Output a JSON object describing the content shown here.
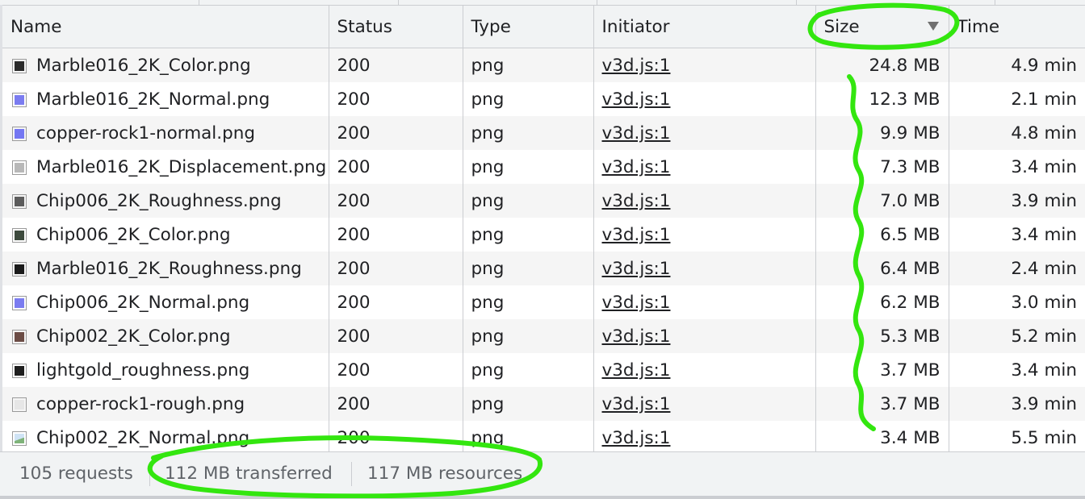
{
  "columns": {
    "name": "Name",
    "status": "Status",
    "type": "Type",
    "initiator": "Initiator",
    "size": "Size",
    "time": "Time"
  },
  "sort": {
    "column": "size",
    "direction": "descending"
  },
  "rows": [
    {
      "name": "Marble016_2K_Color.png",
      "status": "200",
      "type": "png",
      "initiator": "v3d.js:1",
      "size": "24.8 MB",
      "time": "4.9 min",
      "thumb": "#2b2b2b"
    },
    {
      "name": "Marble016_2K_Normal.png",
      "status": "200",
      "type": "png",
      "initiator": "v3d.js:1",
      "size": "12.3 MB",
      "time": "2.1 min",
      "thumb": "#7b7cf0"
    },
    {
      "name": "copper-rock1-normal.png",
      "status": "200",
      "type": "png",
      "initiator": "v3d.js:1",
      "size": "9.9 MB",
      "time": "4.8 min",
      "thumb": "#7477f2"
    },
    {
      "name": "Marble016_2K_Displacement.png",
      "status": "200",
      "type": "png",
      "initiator": "v3d.js:1",
      "size": "7.3 MB",
      "time": "3.4 min",
      "thumb": "#b8b8b8"
    },
    {
      "name": "Chip006_2K_Roughness.png",
      "status": "200",
      "type": "png",
      "initiator": "v3d.js:1",
      "size": "7.0 MB",
      "time": "3.9 min",
      "thumb": "#5c5c5c"
    },
    {
      "name": "Chip006_2K_Color.png",
      "status": "200",
      "type": "png",
      "initiator": "v3d.js:1",
      "size": "6.5 MB",
      "time": "3.4 min",
      "thumb": "#3d4a3d"
    },
    {
      "name": "Marble016_2K_Roughness.png",
      "status": "200",
      "type": "png",
      "initiator": "v3d.js:1",
      "size": "6.4 MB",
      "time": "2.4 min",
      "thumb": "#1a1a1a"
    },
    {
      "name": "Chip006_2K_Normal.png",
      "status": "200",
      "type": "png",
      "initiator": "v3d.js:1",
      "size": "6.2 MB",
      "time": "3.0 min",
      "thumb": "#7b7cf0"
    },
    {
      "name": "Chip002_2K_Color.png",
      "status": "200",
      "type": "png",
      "initiator": "v3d.js:1",
      "size": "5.3 MB",
      "time": "5.2 min",
      "thumb": "#6b4c45"
    },
    {
      "name": "lightgold_roughness.png",
      "status": "200",
      "type": "png",
      "initiator": "v3d.js:1",
      "size": "3.7 MB",
      "time": "3.4 min",
      "thumb": "#1e1e1e"
    },
    {
      "name": "copper-rock1-rough.png",
      "status": "200",
      "type": "png",
      "initiator": "v3d.js:1",
      "size": "3.7 MB",
      "time": "3.9 min",
      "thumb": "#e6e6e6"
    },
    {
      "name": "Chip002_2K_Normal.png",
      "status": "200",
      "type": "png",
      "initiator": "v3d.js:1",
      "size": "3.4 MB",
      "time": "5.5 min",
      "thumb": "image-placeholder-icon"
    }
  ],
  "footer": {
    "requests": "105 requests",
    "transferred": "112 MB transferred",
    "resources": "117 MB resources"
  },
  "colors": {
    "annotation": "#33e60f",
    "header_bg": "#f1f3f4",
    "stripe_bg": "#f5f5f5"
  }
}
